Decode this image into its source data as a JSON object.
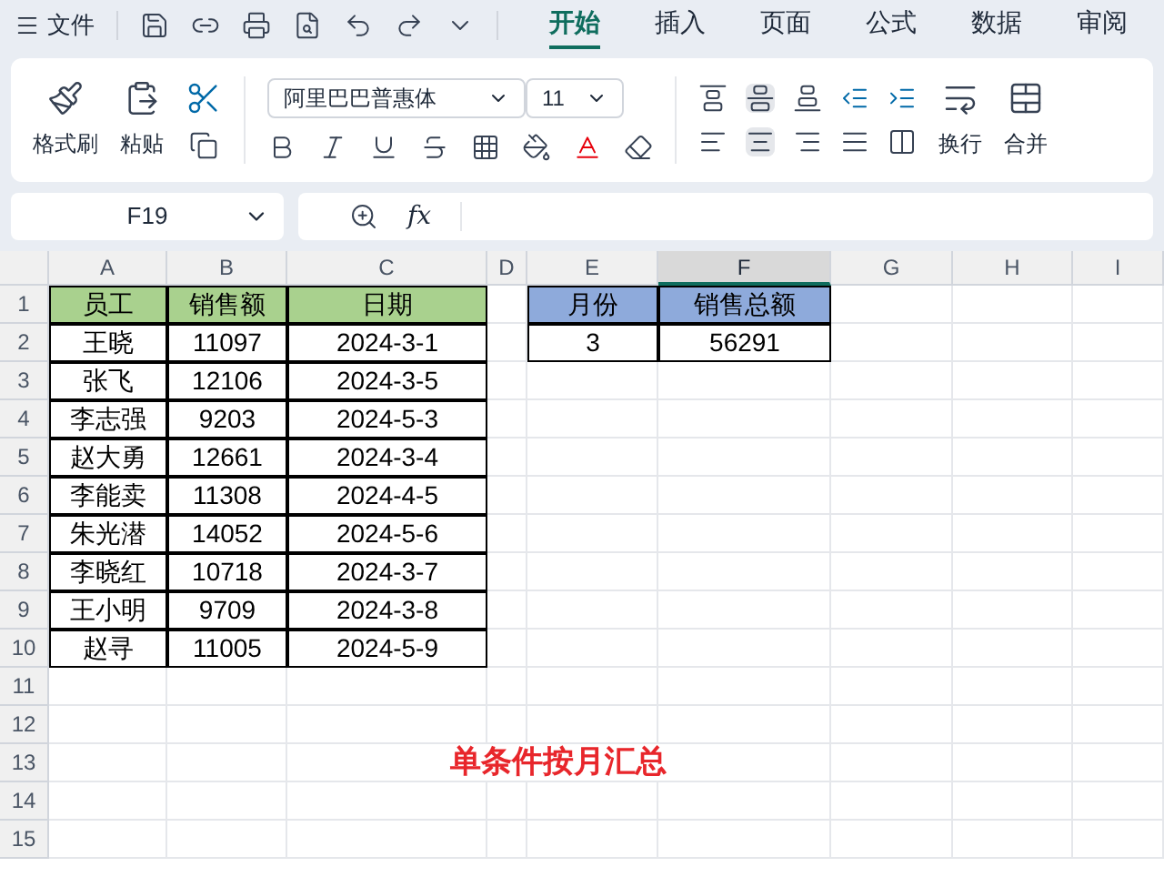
{
  "menu": {
    "file": "文件",
    "tabs": [
      {
        "label": "开始",
        "selected": true
      },
      {
        "label": "插入",
        "selected": false
      },
      {
        "label": "页面",
        "selected": false
      },
      {
        "label": "公式",
        "selected": false
      },
      {
        "label": "数据",
        "selected": false
      },
      {
        "label": "审阅",
        "selected": false
      }
    ]
  },
  "ribbon": {
    "format_painter": "格式刷",
    "paste": "粘贴",
    "font_name": "阿里巴巴普惠体",
    "font_size": "11",
    "wrap": "换行",
    "merge": "合并"
  },
  "formula_bar": {
    "name_box": "F19",
    "fx": "fx"
  },
  "sheet": {
    "columns": [
      {
        "label": "A",
        "selected": false
      },
      {
        "label": "B",
        "selected": false
      },
      {
        "label": "C",
        "selected": false
      },
      {
        "label": "D",
        "selected": false
      },
      {
        "label": "E",
        "selected": false
      },
      {
        "label": "F",
        "selected": true
      },
      {
        "label": "G",
        "selected": false
      },
      {
        "label": "H",
        "selected": false
      },
      {
        "label": "I",
        "selected": false
      }
    ],
    "rows": [
      "1",
      "2",
      "3",
      "4",
      "5",
      "6",
      "7",
      "8",
      "9",
      "10",
      "11",
      "12",
      "13",
      "14",
      "15"
    ],
    "tables": [
      {
        "header": [
          "员工",
          "销售额",
          "日期"
        ],
        "rows": [
          [
            "王晓",
            "11097",
            "2024-3-1"
          ],
          [
            "张飞",
            "12106",
            "2024-3-5"
          ],
          [
            "李志强",
            "9203",
            "2024-5-3"
          ],
          [
            "赵大勇",
            "12661",
            "2024-3-4"
          ],
          [
            "李能卖",
            "11308",
            "2024-4-5"
          ],
          [
            "朱光潜",
            "14052",
            "2024-5-6"
          ],
          [
            "李晓红",
            "10718",
            "2024-3-7"
          ],
          [
            "王小明",
            "9709",
            "2024-3-8"
          ],
          [
            "赵寻",
            "11005",
            "2024-5-9"
          ]
        ]
      },
      {
        "header": [
          "月份",
          "销售总额"
        ],
        "rows": [
          [
            "3",
            "56291"
          ]
        ]
      }
    ],
    "caption": "单条件按月汇总"
  }
}
